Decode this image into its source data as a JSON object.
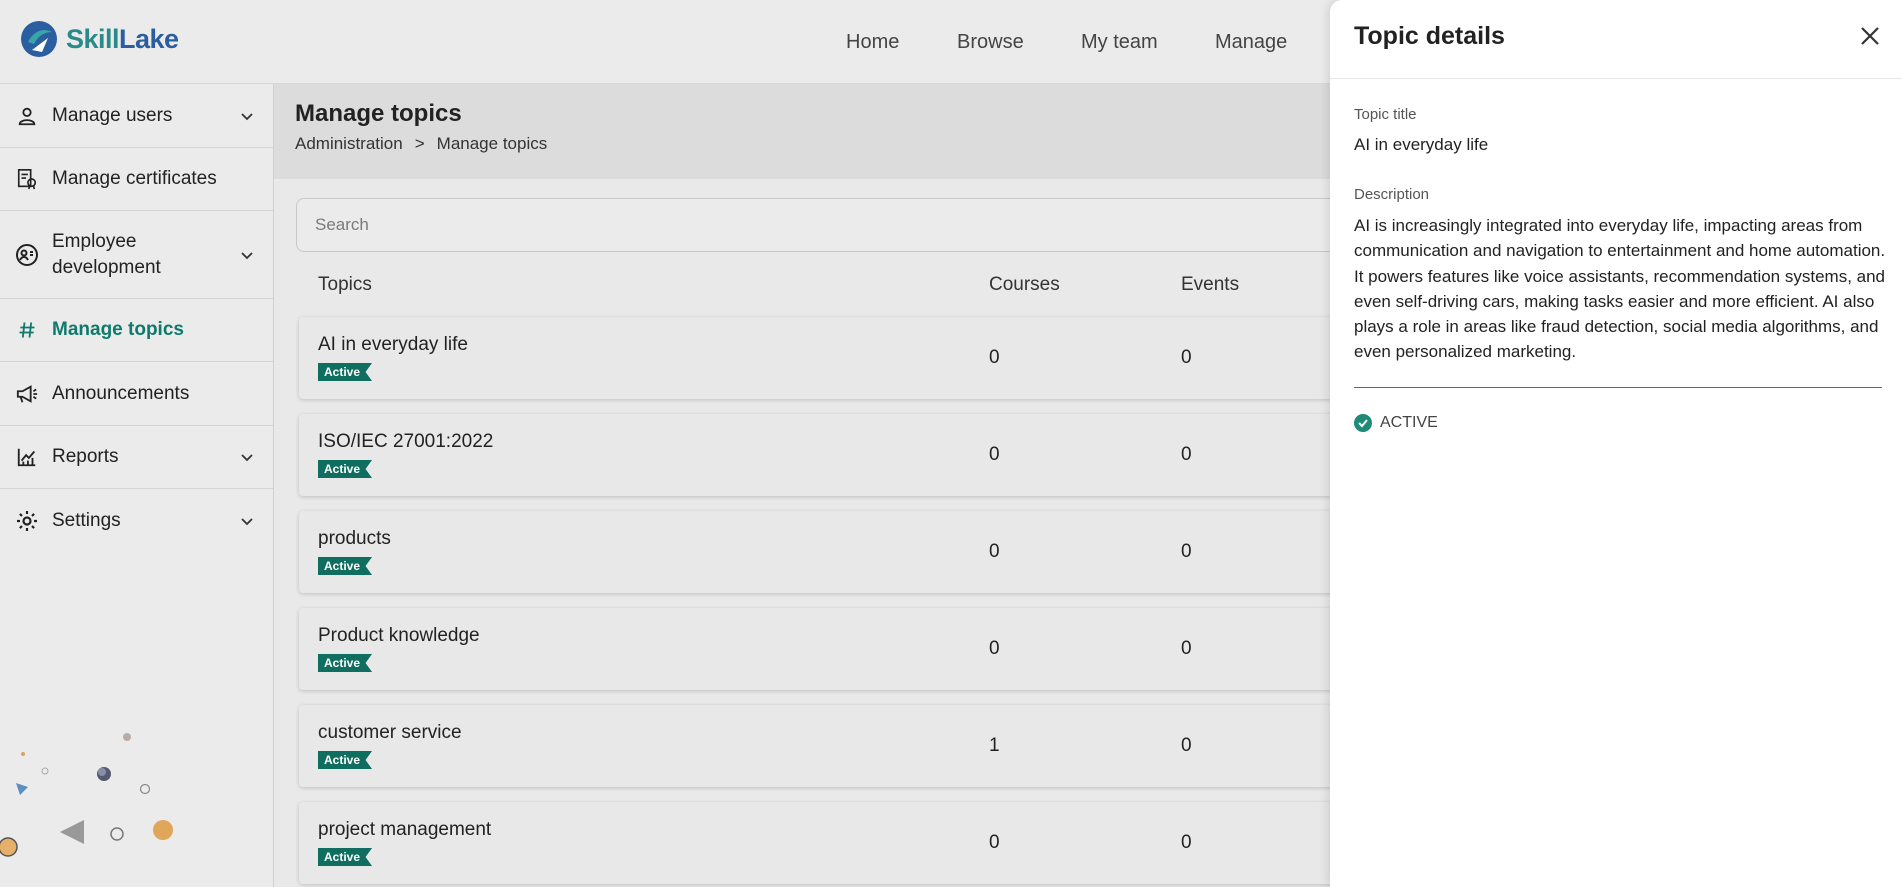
{
  "app": {
    "brand_part1": "Skill",
    "brand_part2": "Lake"
  },
  "nav": {
    "home": "Home",
    "browse": "Browse",
    "my_team": "My team",
    "manage": "Manage"
  },
  "sidebar": {
    "items": [
      {
        "label": "Manage users"
      },
      {
        "label": "Manage certificates"
      },
      {
        "label": "Employee development"
      },
      {
        "label": "Manage topics"
      },
      {
        "label": "Announcements"
      },
      {
        "label": "Reports"
      },
      {
        "label": "Settings"
      }
    ]
  },
  "page": {
    "title": "Manage topics",
    "breadcrumb": {
      "root": "Administration",
      "separator": ">",
      "current": "Manage topics"
    },
    "search_placeholder": "Search"
  },
  "table": {
    "headers": {
      "topics": "Topics",
      "courses": "Courses",
      "events": "Events"
    },
    "rows": [
      {
        "name": "AI in everyday life",
        "status": "Active",
        "courses": "0",
        "events": "0"
      },
      {
        "name": "ISO/IEC 27001:2022",
        "status": "Active",
        "courses": "0",
        "events": "0"
      },
      {
        "name": "products",
        "status": "Active",
        "courses": "0",
        "events": "0"
      },
      {
        "name": "Product knowledge",
        "status": "Active",
        "courses": "0",
        "events": "0"
      },
      {
        "name": "customer service",
        "status": "Active",
        "courses": "1",
        "events": "0"
      },
      {
        "name": "project management",
        "status": "Active",
        "courses": "0",
        "events": "0"
      }
    ]
  },
  "panel": {
    "title": "Topic details",
    "topic_title_label": "Topic title",
    "topic_title_value": "AI in everyday life",
    "description_label": "Description",
    "description_value": "AI is increasingly integrated into everyday life, impacting areas from communication and navigation to entertainment and home automation. It powers features like voice assistants, recommendation systems, and even self-driving cars, making tasks easier and more efficient. AI also plays a role in areas like fraud detection, social media algorithms, and even personalized marketing.",
    "status": "ACTIVE"
  },
  "colors": {
    "accent": "#0f7a6b",
    "badge": "#0f6e5f",
    "brand_teal": "#2a8a8a",
    "brand_blue": "#2b5ea0"
  }
}
